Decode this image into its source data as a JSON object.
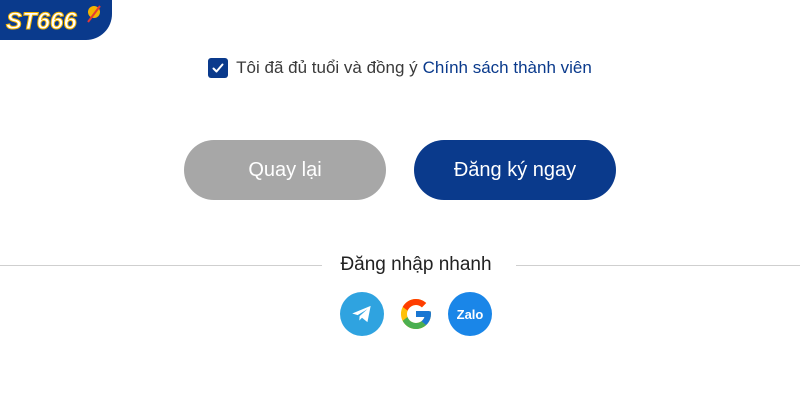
{
  "logo": {
    "text": "ST666",
    "icon": "st666-logo-icon"
  },
  "agreement": {
    "checked": true,
    "text": "Tôi đã đủ tuổi và đồng ý",
    "link_text": "Chính sách thành viên"
  },
  "buttons": {
    "back_label": "Quay lại",
    "register_label": "Đăng ký ngay"
  },
  "quick_login": {
    "label": "Đăng nhập nhanh",
    "providers": [
      {
        "name": "telegram",
        "icon": "telegram-icon"
      },
      {
        "name": "google",
        "icon": "google-icon"
      },
      {
        "name": "zalo",
        "icon": "zalo-icon",
        "text": "Zalo"
      }
    ]
  },
  "colors": {
    "primary": "#0a3a8c",
    "back_button": "#a7a7a7",
    "telegram": "#2fa3e0",
    "zalo": "#1a86e8",
    "divider": "#cfcfcf"
  }
}
